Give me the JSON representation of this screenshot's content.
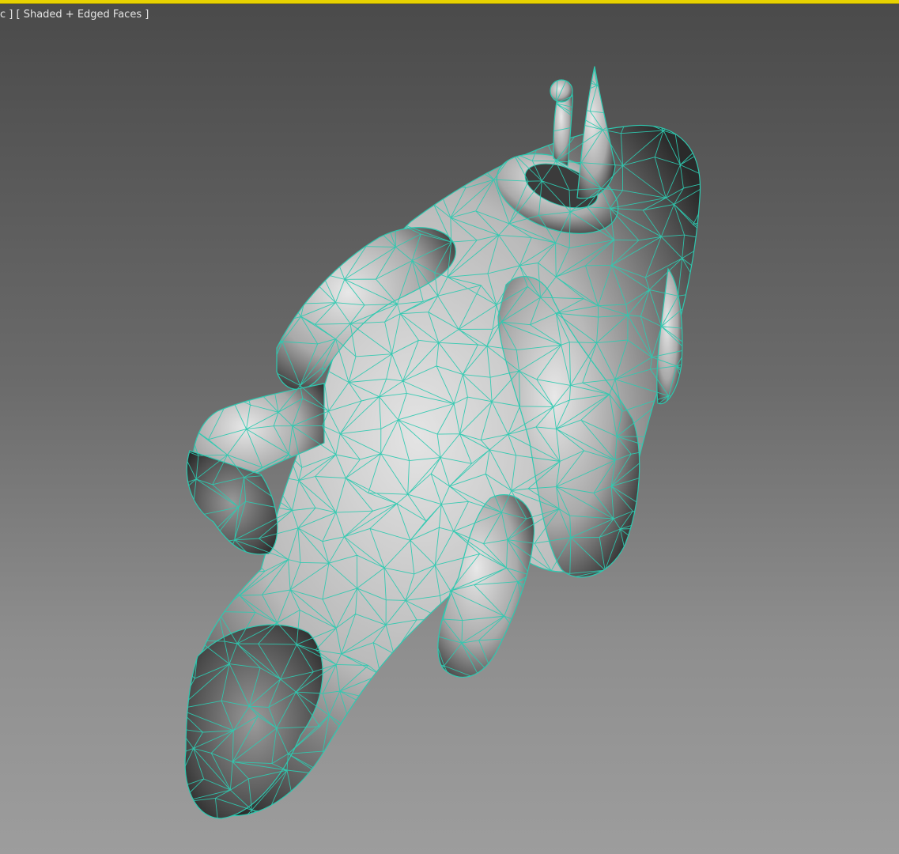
{
  "viewport": {
    "label_prefix": "c ]",
    "shading_mode_label": "[ Shaded + Edged Faces ]",
    "active_border_color": "#e8d200",
    "wire_color": "#2ec9b0",
    "mesh_description_icon": "3d-model-icon"
  }
}
